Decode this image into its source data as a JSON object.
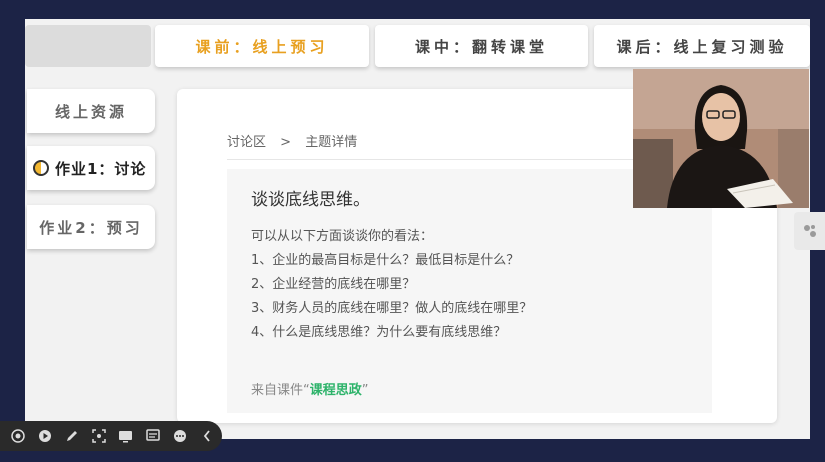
{
  "tabs": [
    {
      "label": ""
    },
    {
      "label": "课前：线上预习"
    },
    {
      "label": "课中：翻转课堂"
    },
    {
      "label": "课后：线上复习测验"
    }
  ],
  "sidebar": {
    "items": [
      {
        "label": "线上资源"
      },
      {
        "label": "作业1：讨论"
      },
      {
        "label": "作业2：预习"
      }
    ]
  },
  "breadcrumb": {
    "root": "讨论区",
    "separator": ">",
    "current": "主题详情"
  },
  "post": {
    "title": "谈谈底线思维。",
    "intro": "可以从以下方面谈谈你的看法：",
    "questions": [
      "1、企业的最高目标是什么？最低目标是什么？",
      "2、企业经营的底线在哪里？",
      "3、财务人员的底线在哪里？做人的底线在哪里？",
      "4、什么是底线思维？为什么要有底线思维？"
    ],
    "source_prefix": "来自课件“",
    "source_link": "课程思政",
    "source_suffix": "”"
  },
  "colors": {
    "active_tab": "#e8a020",
    "link_green": "#2db36a",
    "frame": "#1c2346"
  },
  "toolbar": {
    "icons": [
      "record-icon",
      "play-icon",
      "pen-icon",
      "screenshot-icon",
      "screen-icon",
      "subtitle-icon",
      "more-icon",
      "collapse-icon"
    ]
  },
  "video": {
    "subject": "presenter-webcam"
  }
}
